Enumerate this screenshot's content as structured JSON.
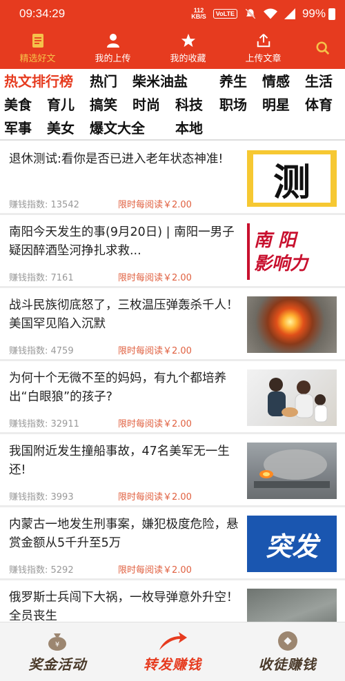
{
  "statusbar": {
    "time": "09:34:29",
    "speed_top": "112",
    "speed_bottom": "KB/S",
    "volte": "VoLTE",
    "battery": "99%"
  },
  "topnav": {
    "items": [
      {
        "label": "精选好文",
        "icon": "document-icon"
      },
      {
        "label": "我的上传",
        "icon": "person-icon"
      },
      {
        "label": "我的收藏",
        "icon": "star-icon"
      },
      {
        "label": "上传文章",
        "icon": "upload-icon"
      }
    ],
    "search_icon": "search-icon",
    "active_color": "#f5c24a",
    "bar_color": "#e63b1f"
  },
  "categories": [
    "热文排行榜",
    "热门",
    "柴米油盐",
    "养生",
    "情感",
    "生活",
    "美食",
    "育儿",
    "搞笑",
    "时尚",
    "科技",
    "职场",
    "明星",
    "体育",
    "军事",
    "美女",
    "爆文大全",
    "本地"
  ],
  "articles": [
    {
      "title": "退休测试:看你是否已进入老年状态神准!",
      "score_label": "赚钱指数: 13542",
      "reward": "限时每阅读￥2.00",
      "thumb_text": "测"
    },
    {
      "title": "南阳今天发生的事(9月20日) | 南阳一男子疑因醉酒坠河挣扎求救...",
      "score_label": "赚钱指数: 7161",
      "reward": "限时每阅读￥2.00",
      "thumb_text": "南 阳\n影响力"
    },
    {
      "title": "战斗民族彻底怒了，三枚温压弹轰杀千人！美国罕见陷入沉默",
      "score_label": "赚钱指数: 4759",
      "reward": "限时每阅读￥2.00",
      "thumb_text": ""
    },
    {
      "title": "为何十个无微不至的妈妈，有九个都培养出“白眼狼”的孩子?",
      "score_label": "赚钱指数: 32911",
      "reward": "限时每阅读￥2.00",
      "thumb_text": ""
    },
    {
      "title": "我国附近发生撞船事故，47名美军无一生还!",
      "score_label": "赚钱指数: 3993",
      "reward": "限时每阅读￥2.00",
      "thumb_text": ""
    },
    {
      "title": "内蒙古一地发生刑事案，嫌犯极度危险，悬赏金额从5千升至5万",
      "score_label": "赚钱指数: 5292",
      "reward": "限时每阅读￥2.00",
      "thumb_text": "突发"
    },
    {
      "title": "俄罗斯士兵闯下大祸，一枚导弹意外升空！全员丧生",
      "score_label": "",
      "reward": "",
      "thumb_text": ""
    }
  ],
  "bottombar": {
    "items": [
      {
        "label": "奖金活动",
        "icon": "money-bag-icon"
      },
      {
        "label": "转发赚钱",
        "icon": "share-arrow-icon"
      },
      {
        "label": "收徒赚钱",
        "icon": "coin-icon"
      }
    ]
  }
}
